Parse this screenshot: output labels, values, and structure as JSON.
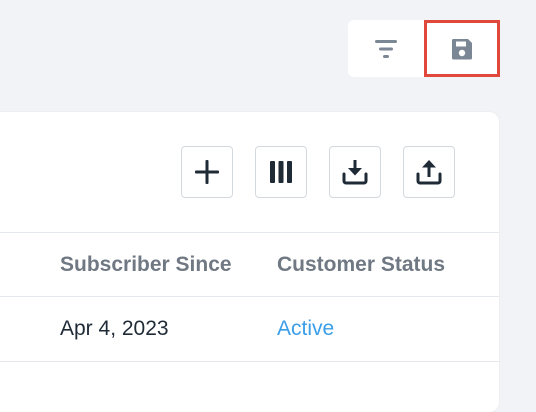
{
  "toolbar": {
    "filter_icon": "filter-lines-icon",
    "save_icon": "floppy-disk-icon",
    "save_highlight_color": "#e0483b"
  },
  "actions": {
    "add_icon": "plus-icon",
    "columns_icon": "columns-icon",
    "import_icon": "download-tray-icon",
    "export_icon": "upload-tray-icon"
  },
  "table": {
    "columns": [
      "Subscriber Since",
      "Customer Status"
    ],
    "rows": [
      {
        "subscriber_since": "Apr 4, 2023",
        "customer_status": "Active"
      }
    ]
  },
  "colors": {
    "background": "#f1f3f7",
    "card": "#ffffff",
    "header_text": "#707983",
    "body_text": "#1f2a37",
    "status_active": "#3b9ee8",
    "icon_dark": "#1f2a37",
    "icon_muted": "#7b8794"
  }
}
